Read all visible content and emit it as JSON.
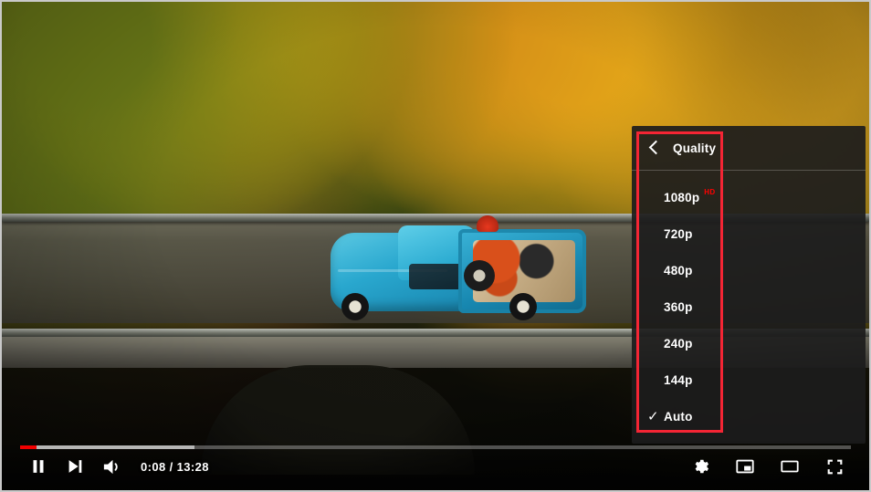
{
  "player": {
    "type": "video-player",
    "video_description": "Aerial view of a blue vintage pickup truck with cargo crossing a guardrail bridge surrounded by autumn foliage"
  },
  "settings_menu": {
    "header": {
      "back_icon": "chevron-left-icon",
      "title": "Quality"
    },
    "items": [
      {
        "label": "1080p",
        "badge": "HD",
        "checked": false
      },
      {
        "label": "720p",
        "badge": "",
        "checked": false
      },
      {
        "label": "480p",
        "badge": "",
        "checked": false
      },
      {
        "label": "360p",
        "badge": "",
        "checked": false
      },
      {
        "label": "240p",
        "badge": "",
        "checked": false
      },
      {
        "label": "144p",
        "badge": "",
        "checked": false
      },
      {
        "label": "Auto",
        "badge": "",
        "checked": true
      }
    ],
    "check_glyph": "✓",
    "hd_badge_color": "#ff0000",
    "panel_background": "#1c1c1c"
  },
  "annotation": {
    "shape": "rectangle",
    "color": "#f42534"
  },
  "controls": {
    "progress": {
      "played_percent": 2,
      "buffered_percent": 21,
      "played_color": "#f00000"
    },
    "left_buttons": [
      {
        "name": "pause-button",
        "icon": "pause-icon"
      },
      {
        "name": "next-video-button",
        "icon": "next-track-icon"
      },
      {
        "name": "volume-button",
        "icon": "volume-icon"
      }
    ],
    "time": {
      "current": "0:08",
      "separator": " / ",
      "duration": "13:28",
      "display": "0:08 / 13:28"
    },
    "right_buttons": [
      {
        "name": "settings-button",
        "icon": "gear-icon"
      },
      {
        "name": "miniplayer-button",
        "icon": "miniplayer-icon"
      },
      {
        "name": "theater-mode-button",
        "icon": "theater-icon"
      },
      {
        "name": "fullscreen-button",
        "icon": "fullscreen-icon"
      }
    ]
  }
}
